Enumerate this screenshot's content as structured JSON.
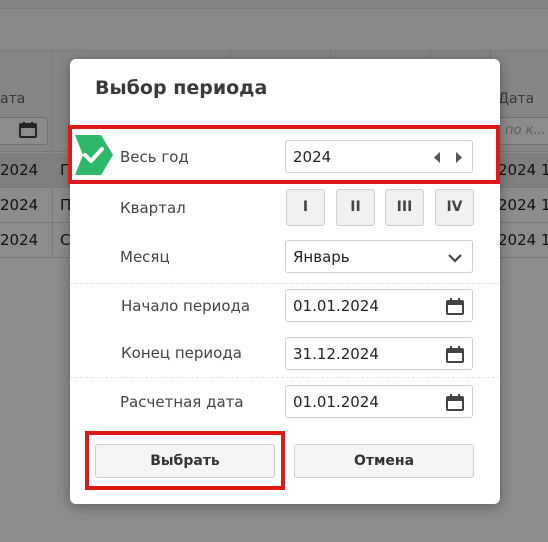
{
  "background": {
    "column_header_left": "ата",
    "column_header_right": "Дата",
    "filter_placeholder": "по к...",
    "rows": [
      {
        "left": "2024",
        "mid": "П",
        "right": "2024 1"
      },
      {
        "left": "2024",
        "mid": "П",
        "right": "2024 1"
      },
      {
        "left": "2024",
        "mid": "С",
        "right": "2024 1"
      }
    ]
  },
  "dialog": {
    "title": "Выбор периода",
    "whole_year": {
      "label": "Весь год",
      "value": "2024",
      "prev_icon": "triangle-left-icon",
      "next_icon": "triangle-right-icon",
      "selected_icon": "check-icon"
    },
    "quarter": {
      "label": "Квартал",
      "buttons": [
        "I",
        "II",
        "III",
        "IV"
      ]
    },
    "month": {
      "label": "Месяц",
      "value": "Январь",
      "icon": "chevron-down-icon"
    },
    "period_start": {
      "label": "Начало периода",
      "value": "01.01.2024",
      "icon": "calendar-icon"
    },
    "period_end": {
      "label": "Конец периода",
      "value": "31.12.2024",
      "icon": "calendar-icon"
    },
    "calc_date": {
      "label": "Расчетная дата",
      "value": "01.01.2024",
      "icon": "calendar-icon"
    },
    "select_button": "Выбрать",
    "cancel_button": "Отмена"
  },
  "colors": {
    "accent_green": "#2eb86a",
    "highlight_red": "#e01818"
  }
}
